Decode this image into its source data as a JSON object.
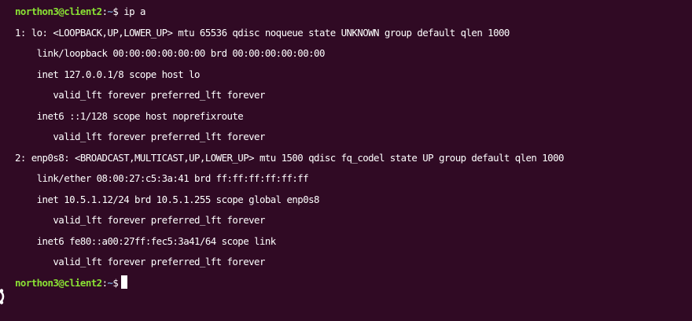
{
  "terminal": {
    "prompt_user_host": "northon3@client2",
    "prompt_colon": ":",
    "prompt_path": "~",
    "prompt_symbol": "$",
    "command": "ip a",
    "output": [
      "1: lo: <LOOPBACK,UP,LOWER_UP> mtu 65536 qdisc noqueue state UNKNOWN group default qlen 1000",
      "    link/loopback 00:00:00:00:00:00 brd 00:00:00:00:00:00",
      "    inet 127.0.0.1/8 scope host lo",
      "       valid_lft forever preferred_lft forever",
      "    inet6 ::1/128 scope host noprefixroute",
      "       valid_lft forever preferred_lft forever",
      "2: enp0s8: <BROADCAST,MULTICAST,UP,LOWER_UP> mtu 1500 qdisc fq_codel state UP group default qlen 1000",
      "    link/ether 08:00:27:c5:3a:41 brd ff:ff:ff:ff:ff:ff",
      "    inet 10.5.1.12/24 brd 10.5.1.255 scope global enp0s8",
      "       valid_lft forever preferred_lft forever",
      "    inet6 fe80::a00:27ff:fec5:3a41/64 scope link",
      "       valid_lft forever preferred_lft forever"
    ]
  },
  "colors": {
    "background": "#300a24",
    "prompt_user": "#8ae234",
    "prompt_path": "#729fcf",
    "text": "#ffffff"
  },
  "icons": {
    "side_logo": "ubuntu-logo-icon"
  }
}
